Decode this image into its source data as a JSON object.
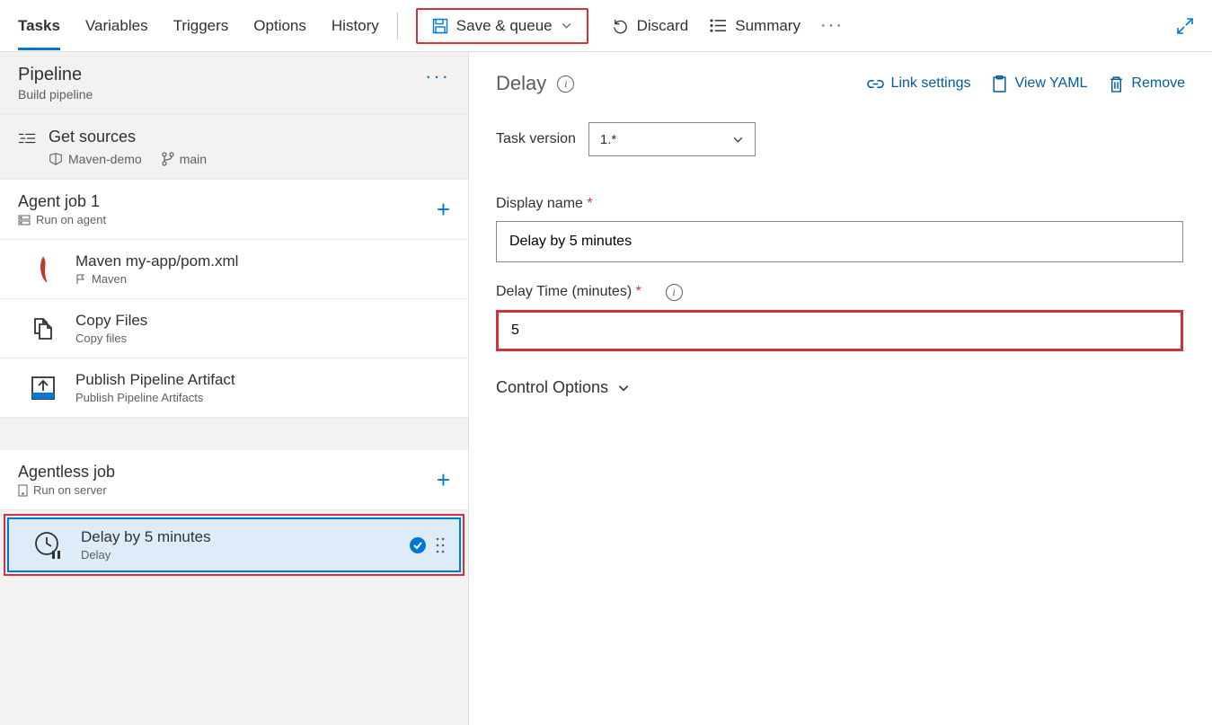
{
  "tabs": [
    "Tasks",
    "Variables",
    "Triggers",
    "Options",
    "History"
  ],
  "active_tab": 0,
  "toolbar": {
    "save_queue": "Save & queue",
    "discard": "Discard",
    "summary": "Summary"
  },
  "pipeline": {
    "title": "Pipeline",
    "subtitle": "Build pipeline"
  },
  "sources": {
    "title": "Get sources",
    "repo": "Maven-demo",
    "branch": "main"
  },
  "agent_job": {
    "title": "Agent job 1",
    "subtitle": "Run on agent",
    "tasks": [
      {
        "title": "Maven my-app/pom.xml",
        "sub": "Maven",
        "icon": "feather"
      },
      {
        "title": "Copy Files",
        "sub": "Copy files",
        "icon": "copy"
      },
      {
        "title": "Publish Pipeline Artifact",
        "sub": "Publish Pipeline Artifacts",
        "icon": "upload"
      }
    ]
  },
  "agentless_job": {
    "title": "Agentless job",
    "subtitle": "Run on server",
    "tasks": [
      {
        "title": "Delay by 5 minutes",
        "sub": "Delay",
        "icon": "clock"
      }
    ]
  },
  "detail": {
    "heading": "Delay",
    "actions": {
      "link": "Link settings",
      "yaml": "View YAML",
      "remove": "Remove"
    },
    "task_version_label": "Task version",
    "task_version_value": "1.*",
    "display_name_label": "Display name",
    "display_name_value": "Delay by 5 minutes",
    "delay_time_label": "Delay Time (minutes)",
    "delay_time_value": "5",
    "control_options": "Control Options"
  }
}
